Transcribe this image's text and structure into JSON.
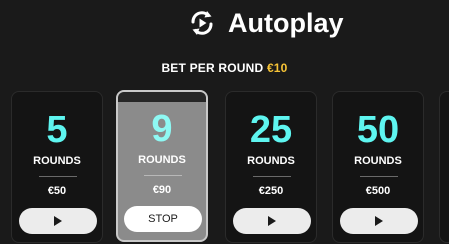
{
  "header": {
    "title": "Autoplay",
    "icon": "autoplay-cycle-icon"
  },
  "bet": {
    "label": "BET PER ROUND",
    "value": "€10",
    "value_color": "#f7c436"
  },
  "colors": {
    "accent_cyan": "#5ef5f0",
    "background": "#1a1a1a"
  },
  "options": [
    {
      "rounds": "5",
      "rounds_label": "ROUNDS",
      "amount": "€50",
      "action": "play-icon",
      "selected": false
    },
    {
      "rounds": "9",
      "rounds_label": "ROUNDS",
      "amount": "€90",
      "action_label": "STOP",
      "selected": true
    },
    {
      "rounds": "25",
      "rounds_label": "ROUNDS",
      "amount": "€250",
      "action": "play-icon",
      "selected": false
    },
    {
      "rounds": "50",
      "rounds_label": "ROUNDS",
      "amount": "€500",
      "action": "play-icon",
      "selected": false
    }
  ]
}
